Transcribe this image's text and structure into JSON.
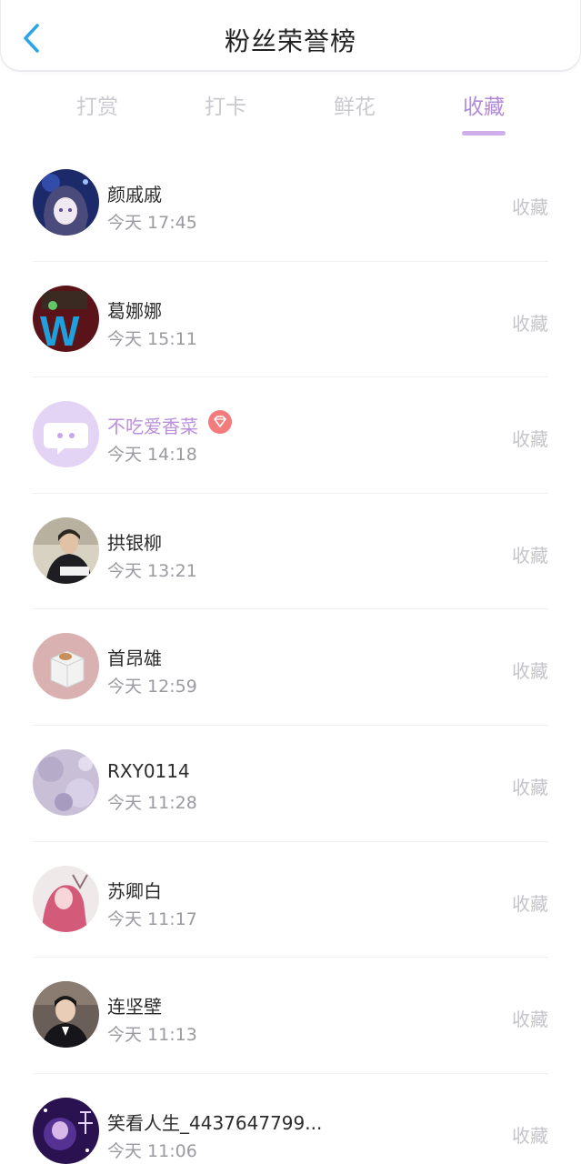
{
  "header": {
    "title": "粉丝荣誉榜",
    "back_icon": "chevron-left-icon",
    "accent_color": "#2aa6e8"
  },
  "tabs": [
    {
      "label": "打赏",
      "active": false
    },
    {
      "label": "打卡",
      "active": false
    },
    {
      "label": "鲜花",
      "active": false
    },
    {
      "label": "收藏",
      "active": true
    }
  ],
  "active_tab_color": "#b38ad8",
  "fans": [
    {
      "name": "颜戚戚",
      "time": "今天 17:45",
      "action": "收藏",
      "vip": false
    },
    {
      "name": "葛娜娜",
      "time": "今天 15:11",
      "action": "收藏",
      "vip": false
    },
    {
      "name": "不吃爱香菜",
      "time": "今天 14:18",
      "action": "收藏",
      "vip": true,
      "badge_icon": "diamond-icon"
    },
    {
      "name": "拱银柳",
      "time": "今天 13:21",
      "action": "收藏",
      "vip": false
    },
    {
      "name": "首昂雄",
      "time": "今天 12:59",
      "action": "收藏",
      "vip": false
    },
    {
      "name": "RXY0114",
      "time": "今天 11:28",
      "action": "收藏",
      "vip": false
    },
    {
      "name": "苏卿白",
      "time": "今天 11:17",
      "action": "收藏",
      "vip": false
    },
    {
      "name": "连坚壁",
      "time": "今天 11:13",
      "action": "收藏",
      "vip": false
    },
    {
      "name": "笑看人生_4437647799...",
      "time": "今天 11:06",
      "action": "收藏",
      "vip": false
    }
  ]
}
